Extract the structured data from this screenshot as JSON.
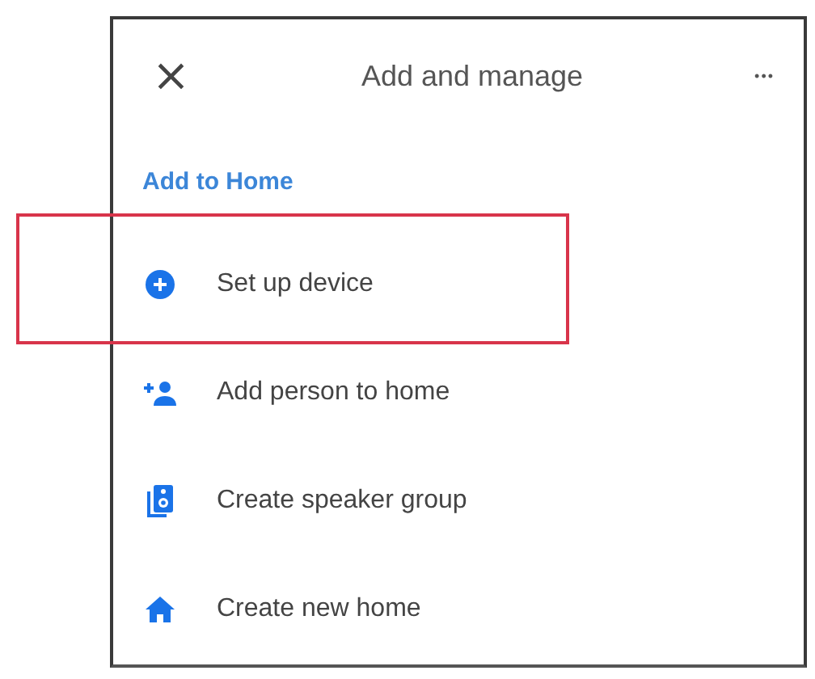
{
  "header": {
    "close": "×",
    "title": "Add and manage",
    "more": "•••"
  },
  "section_title": "Add to Home",
  "items": [
    {
      "kind": "setup",
      "label": "Set up device",
      "highlighted": true
    },
    {
      "kind": "person",
      "label": "Add person to home",
      "highlighted": false
    },
    {
      "kind": "speaker",
      "label": "Create speaker group",
      "highlighted": false
    },
    {
      "kind": "home",
      "label": "Create new home",
      "highlighted": false
    }
  ]
}
